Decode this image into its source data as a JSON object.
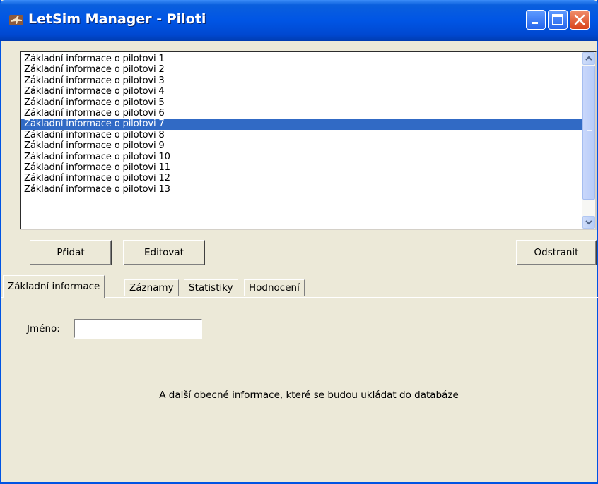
{
  "window": {
    "title": "LetSim Manager - Piloti",
    "icon": "airplane-icon"
  },
  "pilot_list": {
    "items": [
      "Základní informace o pilotovi 1",
      "Základní informace o pilotovi 2",
      "Základní informace o pilotovi 3",
      "Základní informace o pilotovi 4",
      "Základní informace o pilotovi 5",
      "Základní informace o pilotovi 6",
      "Základní informace o pilotovi 7",
      "Základní informace o pilotovi 8",
      "Základní informace o pilotovi 9",
      "Základní informace o pilotovi 10",
      "Základní informace o pilotovi 11",
      "Základní informace o pilotovi 12",
      "Základní informace o pilotovi 13"
    ],
    "selected_index": 6
  },
  "buttons": {
    "add": "Přidat",
    "edit": "Editovat",
    "remove": "Odstranit"
  },
  "tabs": [
    {
      "label": "Základní informace",
      "active": true
    },
    {
      "label": "Záznamy",
      "active": false
    },
    {
      "label": "Statistiky",
      "active": false
    },
    {
      "label": "Hodnocení",
      "active": false
    }
  ],
  "basic_info": {
    "name_label": "Jméno:",
    "name_value": "",
    "note": "A další obecné informace, které se budou ukládat do databáze"
  },
  "colors": {
    "title_bar": "#0055e5",
    "selection": "#316ac5",
    "window_bg": "#ece9d8"
  }
}
